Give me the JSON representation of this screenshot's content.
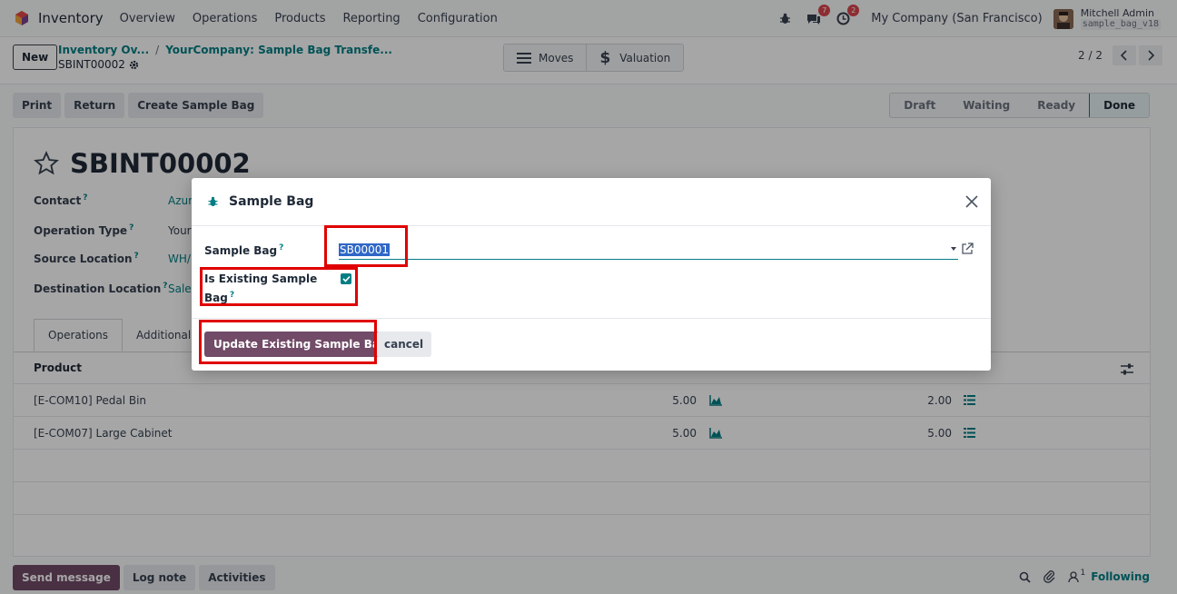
{
  "navbar": {
    "app_name": "Inventory",
    "menus": [
      "Overview",
      "Operations",
      "Products",
      "Reporting",
      "Configuration"
    ],
    "chat_badge": "7",
    "activity_badge": "2",
    "company": "My Company (San Francisco)",
    "user_name": "Mitchell Admin",
    "db_name": "sample_bag_v18"
  },
  "control": {
    "new_label": "New",
    "breadcrumb_1": "Inventory Ov...",
    "breadcrumb_2": "YourCompany: Sample Bag Transfe...",
    "record_name": "SBINT00002",
    "smart_moves": "Moves",
    "smart_valuation": "Valuation",
    "pager": "2 / 2"
  },
  "actions": {
    "print": "Print",
    "return": "Return",
    "create_sample_bag": "Create Sample Bag"
  },
  "stages": [
    "Draft",
    "Waiting",
    "Ready",
    "Done"
  ],
  "form": {
    "title": "SBINT00002",
    "contact_label": "Contact",
    "contact_value": "Azur",
    "operation_type_label": "Operation Type",
    "operation_type_value": "Your",
    "source_location_label": "Source Location",
    "source_location_value": "WH/",
    "destination_location_label": "Destination Location",
    "destination_location_value": "Sales",
    "tab_operations": "Operations",
    "tab_additional": "Additional I",
    "product_header": "Product",
    "rows": [
      {
        "product": "[E-COM10] Pedal Bin",
        "demand": "5.00",
        "quantity": "2.00"
      },
      {
        "product": "[E-COM07] Large Cabinet",
        "demand": "5.00",
        "quantity": "5.00"
      }
    ]
  },
  "chatter": {
    "send_message": "Send message",
    "log_note": "Log note",
    "activities": "Activities",
    "followers_count": "1",
    "following": "Following"
  },
  "modal": {
    "title": "Sample Bag",
    "sample_bag_label": "Sample Bag",
    "sample_bag_value": "SB00001",
    "is_existing_label_1": "Is Existing Sample",
    "is_existing_label_2": "Bag",
    "is_existing_checked": true,
    "help_mark": "?",
    "update_button": "Update Existing Sample Bag",
    "cancel_button": "cancel"
  },
  "colors": {
    "accent": "#017e84",
    "primary": "#714b67",
    "highlight": "#e00000"
  }
}
